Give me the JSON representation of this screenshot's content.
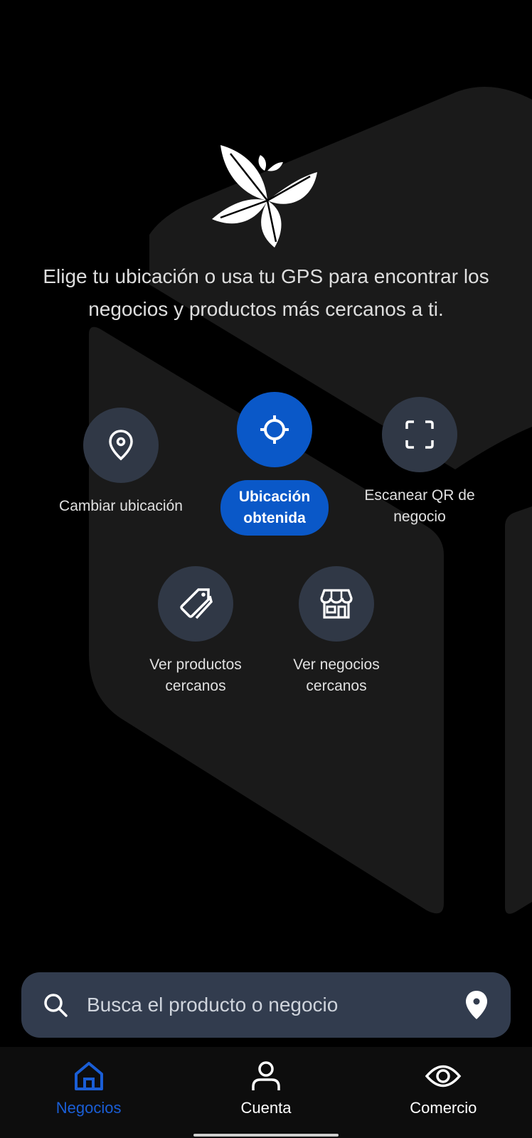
{
  "intro_text": "Elige tu ubicación o usa tu GPS para encontrar los negocios y productos más cercanos a ti.",
  "actions": {
    "change_location": {
      "label": "Cambiar ubicación",
      "icon": "location-pin-icon"
    },
    "location_obtained": {
      "label": "Ubicación obtenida",
      "icon": "crosshair-icon"
    },
    "scan_qr": {
      "label": "Escanear QR de negocio",
      "icon": "scan-frame-icon"
    },
    "nearby_products": {
      "label": "Ver productos cercanos",
      "icon": "tag-icon"
    },
    "nearby_businesses": {
      "label": "Ver negocios cercanos",
      "icon": "store-icon"
    }
  },
  "search": {
    "placeholder": "Busca el producto o negocio",
    "left_icon": "search-icon",
    "right_icon": "location-pin-icon"
  },
  "nav": [
    {
      "label": "Negocios",
      "icon": "home-icon",
      "active": true
    },
    {
      "label": "Cuenta",
      "icon": "person-icon",
      "active": false
    },
    {
      "label": "Comercio",
      "icon": "eye-icon",
      "active": false
    }
  ],
  "colors": {
    "accent": "#0a58c8",
    "nav_active": "#1a5ed6",
    "circle_bg": "#303846",
    "search_bg": "#323c4e",
    "background": "#000000"
  }
}
